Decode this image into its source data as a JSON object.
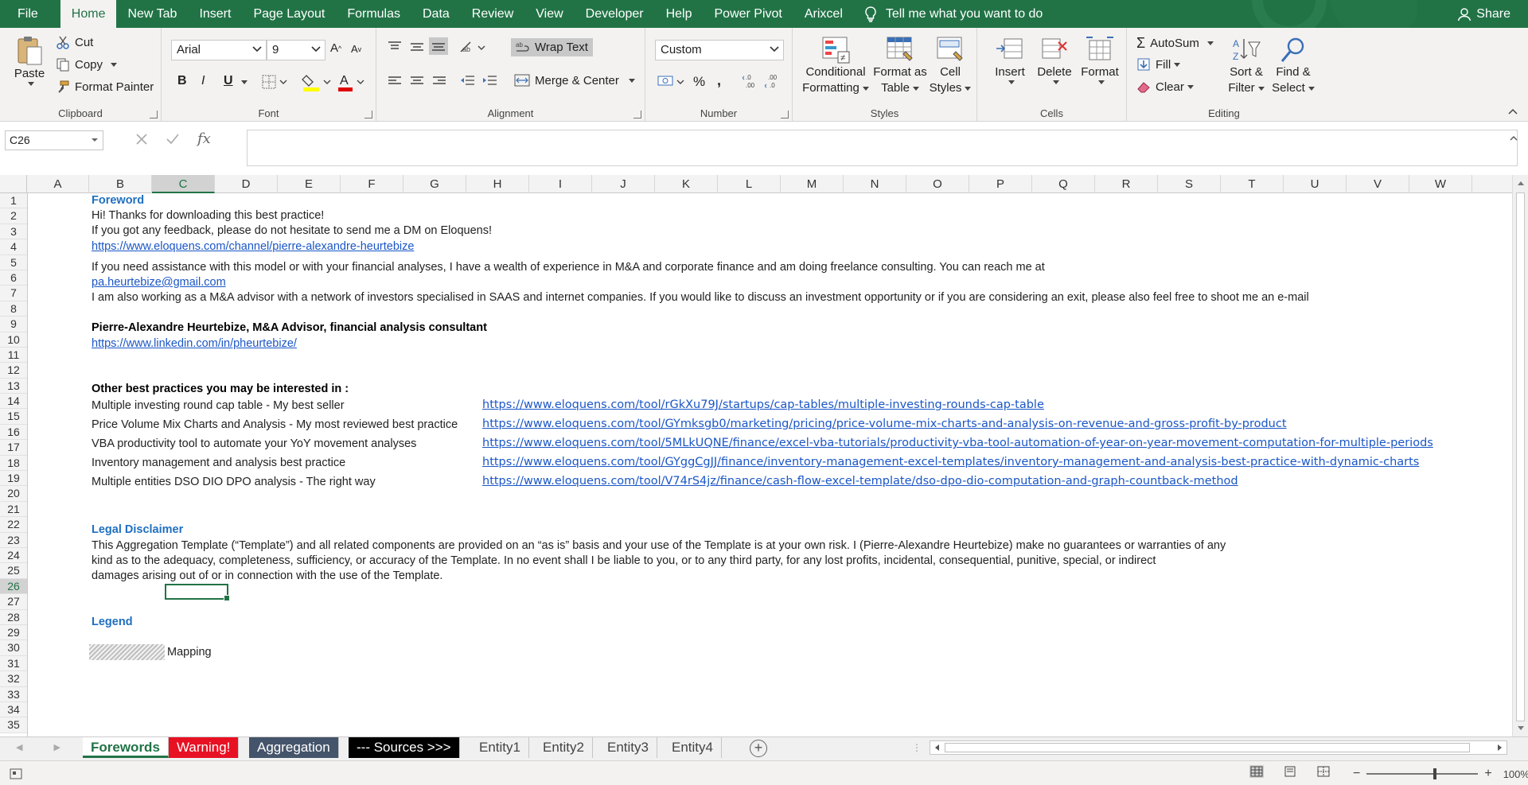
{
  "menu": {
    "file": "File",
    "home": "Home",
    "new_tab": "New Tab",
    "insert": "Insert",
    "page_layout": "Page Layout",
    "formulas": "Formulas",
    "data": "Data",
    "review": "Review",
    "view": "View",
    "developer": "Developer",
    "help": "Help",
    "power_pivot": "Power Pivot",
    "arixcel": "Arixcel",
    "tell_me": "Tell me what you want to do",
    "share": "Share"
  },
  "ribbon": {
    "clipboard": {
      "label": "Clipboard",
      "paste": "Paste",
      "cut": "Cut",
      "copy": "Copy",
      "format_painter": "Format Painter"
    },
    "font": {
      "label": "Font",
      "name": "Arial",
      "size": "9",
      "bold": "B",
      "italic": "I",
      "underline": "U"
    },
    "alignment": {
      "label": "Alignment",
      "wrap_text": "Wrap Text",
      "merge_center": "Merge & Center"
    },
    "number": {
      "label": "Number",
      "format": "Custom",
      "percent": "%",
      "comma": ","
    },
    "styles": {
      "label": "Styles",
      "conditional": "Conditional",
      "conditional2": "Formatting",
      "format_as": "Format as",
      "table": "Table",
      "cell": "Cell",
      "cell_styles": "Styles"
    },
    "cells": {
      "label": "Cells",
      "insert": "Insert",
      "delete": "Delete",
      "format": "Format"
    },
    "editing": {
      "label": "Editing",
      "autosum": "AutoSum",
      "fill": "Fill",
      "clear": "Clear",
      "sort": "Sort &",
      "filter": "Filter",
      "find": "Find &",
      "select": "Select"
    }
  },
  "formula_bar": {
    "name_box": "C26",
    "fx": "fx",
    "value": ""
  },
  "columns": [
    "A",
    "B",
    "C",
    "D",
    "E",
    "F",
    "G",
    "H",
    "I",
    "J",
    "K",
    "L",
    "M",
    "N",
    "O",
    "P",
    "Q",
    "R",
    "S",
    "T",
    "U",
    "V",
    "W"
  ],
  "rows": [
    "1",
    "2",
    "3",
    "4",
    "5",
    "6",
    "7",
    "8",
    "9",
    "10",
    "11",
    "12",
    "13",
    "14",
    "15",
    "16",
    "17",
    "18",
    "19",
    "20",
    "21",
    "22",
    "23",
    "24",
    "25",
    "26",
    "27",
    "28",
    "29",
    "30",
    "31",
    "32",
    "33",
    "34",
    "35"
  ],
  "sheet": {
    "r1": "Foreword",
    "r2": "Hi! Thanks for downloading this best practice!",
    "r3": "If you got any feedback, please do not hesitate to send me a DM on Eloquens!",
    "r4": "https://www.eloquens.com/channel/pierre-alexandre-heurtebize",
    "r6": "If you need assistance with this model or with your financial analyses, I have a wealth of experience in M&A and corporate finance and am doing freelance consulting. You can reach me at",
    "r7": "pa.heurtebize@gmail.com",
    "r8": "I am also working as a M&A advisor with a network of investors specialised in SAAS and internet companies. If you would like to discuss an investment opportunity or if you are considering an exit, please also feel free to shoot me an e-mail",
    "r10": "Pierre-Alexandre Heurtebize, M&A Advisor, financial analysis consultant",
    "r11": "https://www.linkedin.com/in/pheurtebize/",
    "r14": "Other best practices you may be interested in :",
    "practices": [
      {
        "name": "Multiple investing round cap table - My best seller",
        "url": "https://www.eloquens.com/tool/rGkXu79J/startups/cap-tables/multiple-investing-rounds-cap-table"
      },
      {
        "name": "Price Volume Mix Charts and Analysis - My most reviewed best practice",
        "url": "https://www.eloquens.com/tool/GYmksgb0/marketing/pricing/price-volume-mix-charts-and-analysis-on-revenue-and-gross-profit-by-product"
      },
      {
        "name": "VBA productivity tool to automate your YoY movement analyses",
        "url": "https://www.eloquens.com/tool/5MLkUQNE/finance/excel-vba-tutorials/productivity-vba-tool-automation-of-year-on-year-movement-computation-for-multiple-periods"
      },
      {
        "name": "Inventory management and analysis best practice",
        "url": "https://www.eloquens.com/tool/GYggCgJJ/finance/inventory-management-excel-templates/inventory-management-and-analysis-best-practice-with-dynamic-charts"
      },
      {
        "name": "Multiple entities DSO DIO DPO analysis - The right way",
        "url": "https://www.eloquens.com/tool/V74rS4jz/finance/cash-flow-excel-template/dso-dpo-dio-computation-and-graph-countback-method"
      }
    ],
    "r22": "Legal Disclaimer",
    "r23": "This Aggregation Template (“Template”) and all related components are provided on an “as is” basis and your use of the Template is at your own risk.  I (Pierre-Alexandre Heurtebize) make no guarantees or warranties of any",
    "r24": "kind as to the adequacy, completeness, sufficiency, or accuracy of the Template. In no event shall I be liable to you, or to any third party, for any lost profits, incidental, consequential, punitive, special, or indirect",
    "r25": "damages arising out of or in connection with the use of the Template.",
    "r28": "Legend",
    "r30": "Mapping"
  },
  "tabs": [
    "Forewords",
    "Warning!",
    "Aggregation",
    "--- Sources >>>",
    "Entity1",
    "Entity2",
    "Entity3",
    "Entity4"
  ],
  "colors": {
    "excel_green": "#217346",
    "warning_tab": "#e81123",
    "aggregation_tab": "#44546a",
    "sources_tab": "#000000",
    "heading_blue": "#1f6fc0"
  },
  "status": {
    "zoom": "100%"
  }
}
